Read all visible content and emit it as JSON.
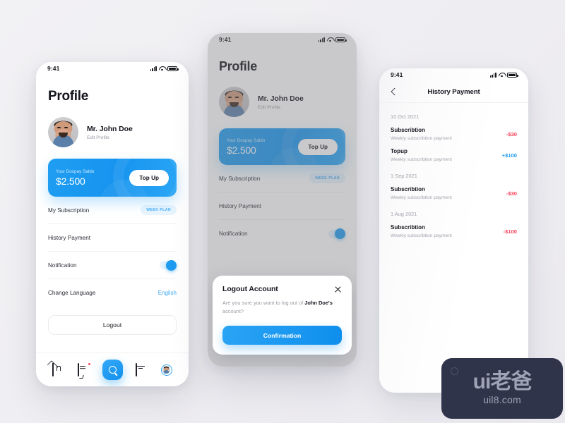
{
  "status_bar": {
    "time": "9:41"
  },
  "phone1": {
    "title": "Profile",
    "user": {
      "name": "Mr. John Doe",
      "edit_label": "Edit Profile"
    },
    "balance": {
      "label": "Your Docpay Saldo",
      "amount": "$2.500",
      "topup_label": "Top Up"
    },
    "menu": [
      {
        "label": "My Subscription",
        "badge": "WEEK PLAN"
      },
      {
        "label": "History Payment"
      },
      {
        "label": "Notification"
      },
      {
        "label": "Change Language",
        "value": "English"
      }
    ],
    "logout_label": "Logout",
    "tabs": [
      {
        "icon": "home-icon"
      },
      {
        "icon": "chat-icon"
      },
      {
        "icon": "search-icon"
      },
      {
        "icon": "calendar-icon"
      },
      {
        "icon": "avatar-icon"
      }
    ]
  },
  "phone2": {
    "title": "Profile",
    "user": {
      "name": "Mr. John Doe",
      "edit_label": "Edit Profile"
    },
    "balance": {
      "label": "Your Docpay Saldo",
      "amount": "$2.500",
      "topup_label": "Top Up"
    },
    "menu": [
      {
        "label": "My Subscription",
        "badge": "WEEK PLAN"
      },
      {
        "label": "History Payment"
      },
      {
        "label": "Notification"
      }
    ],
    "modal": {
      "title": "Logout Account",
      "text_before": "Are you sure you want to log out of ",
      "text_bold": "John Doe's",
      "text_after": " account?",
      "confirm_label": "Confirmation"
    }
  },
  "phone3": {
    "nav_title": "History Payment",
    "groups": [
      {
        "date": "10 Oct 2021",
        "items": [
          {
            "name": "Subscribtion",
            "desc": "Weekly subscribtion payment",
            "amount": "-$30",
            "sign": "neg"
          },
          {
            "name": "Topup",
            "desc": "Weekly subscribtion payment",
            "amount": "+$100",
            "sign": "pos"
          }
        ]
      },
      {
        "date": "1 Sep 2021",
        "items": [
          {
            "name": "Subscribtion",
            "desc": "Weekly subscribtion payment",
            "amount": "-$30",
            "sign": "neg"
          }
        ]
      },
      {
        "date": "1 Aug 2021",
        "items": [
          {
            "name": "Subscribtion",
            "desc": "Weekly subscribtion payment",
            "amount": "-$100",
            "sign": "neg"
          }
        ]
      }
    ]
  },
  "watermark": {
    "main": "ui老爸",
    "sub": "uil8.com"
  },
  "colors": {
    "accent_blue": "#1e9bf0",
    "negative_red": "#f5455c",
    "positive_blue": "#1e9bf0",
    "badge_bg": "#eaf5fe",
    "canvas_bg": "#f0eff3",
    "watermark_bg": "#30344a"
  }
}
